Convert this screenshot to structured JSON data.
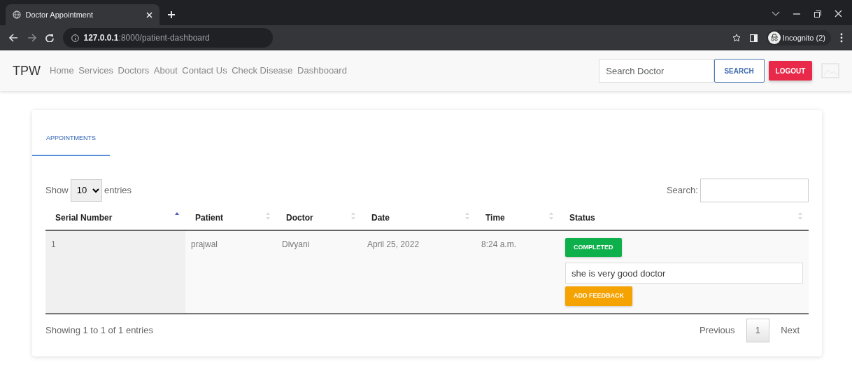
{
  "browser": {
    "tab_title": "Doctor Appointment",
    "url_host": "127.0.0.1",
    "url_path": ":8000/patient-dashboard",
    "profile": "Incognito (2)"
  },
  "navbar": {
    "brand": "TPW",
    "links": [
      "Home",
      "Services",
      "Doctors",
      "About",
      "Contact Us",
      "Check Disease",
      "Dashbooard"
    ],
    "search": {
      "placeholder": "Search Doctor"
    },
    "search_button": "SEARCH",
    "logout_button": "LOGOUT"
  },
  "tabs": [
    {
      "label": "APPOINTMENTS",
      "selected": true
    }
  ],
  "table": {
    "length": {
      "label_before": "Show",
      "value": "10",
      "label_after": "entries"
    },
    "search_label": "Search:",
    "columns": [
      {
        "label": "Serial Number",
        "sorted": true
      },
      {
        "label": "Patient",
        "sorted": false
      },
      {
        "label": "Doctor",
        "sorted": false
      },
      {
        "label": "Date",
        "sorted": false
      },
      {
        "label": "Time",
        "sorted": false
      },
      {
        "label": "Status",
        "sorted": false
      }
    ],
    "rows": [
      {
        "cells": [
          "1",
          "prajwal",
          "Divyani",
          "April 25, 2022",
          "8:24 a.m."
        ],
        "status": {
          "label": "COMPLETED",
          "kind": "success"
        },
        "feedback": "she is very good doctor",
        "feedback_button": "ADD FEEDBACK"
      }
    ],
    "info": "Showing 1 to 1 of 1 entries",
    "pagination": [
      {
        "label": "Previous",
        "selected": false
      },
      {
        "label": "1",
        "selected": true
      },
      {
        "label": "Next",
        "selected": false
      }
    ]
  }
}
